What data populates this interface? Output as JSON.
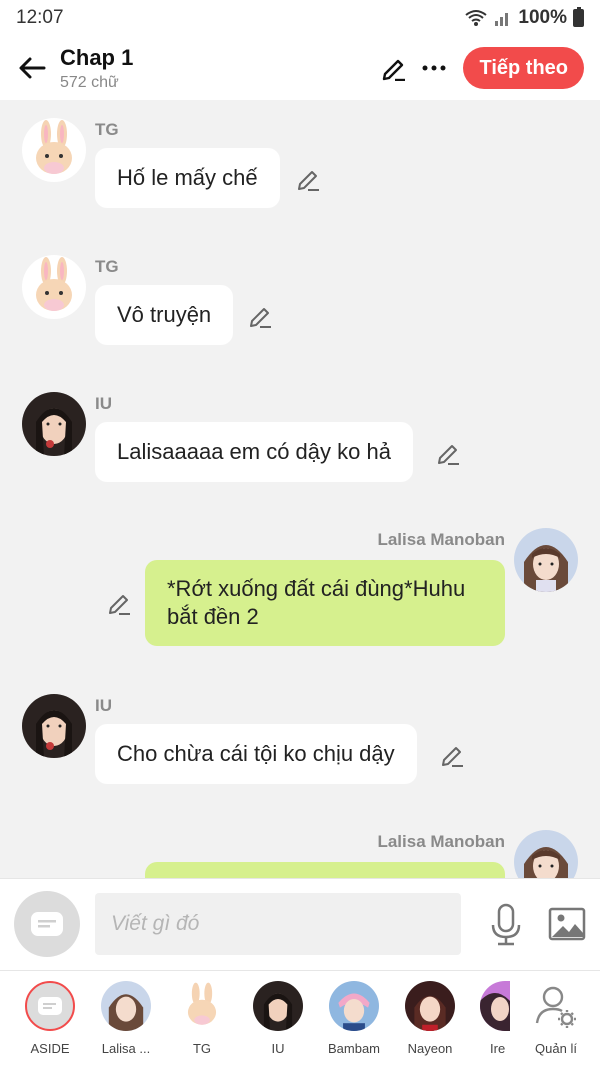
{
  "status": {
    "time": "12:07",
    "battery": "100%"
  },
  "header": {
    "title": "Chap 1",
    "subtitle": "572 chữ",
    "next_label": "Tiếp theo"
  },
  "messages": [
    {
      "sender": "TG",
      "text": "Hố le mấy chế",
      "side": "left",
      "avatar": "bunny"
    },
    {
      "sender": "TG",
      "text": "Vô truyện",
      "side": "left",
      "avatar": "bunny"
    },
    {
      "sender": "IU",
      "text": "Lalisaaaaa em có dậy ko hả",
      "side": "left",
      "avatar": "iu"
    },
    {
      "sender": "Lalisa Manoban",
      "text_line1": "*Rớt xuống đất cái đùng*Huhu",
      "text_line2": "bắt đền 2",
      "side": "right",
      "avatar": "lalisa"
    },
    {
      "sender": "IU",
      "text": "Cho chừa cái tội ko chịu dậy",
      "side": "left",
      "avatar": "iu"
    },
    {
      "sender": "Lalisa Manoban",
      "text": "",
      "side": "right",
      "avatar": "lalisa"
    }
  ],
  "input": {
    "placeholder": "Viết gì đó"
  },
  "characters": [
    {
      "label": "ASIDE"
    },
    {
      "label": "Lalisa ..."
    },
    {
      "label": "TG"
    },
    {
      "label": "IU"
    },
    {
      "label": "Bambam"
    },
    {
      "label": "Nayeon"
    },
    {
      "label": "Ire"
    },
    {
      "label": "Quản lí"
    }
  ],
  "colors": {
    "accent": "#f24b4b",
    "green_bubble": "#d6f08e",
    "background": "#f2f2f2"
  }
}
